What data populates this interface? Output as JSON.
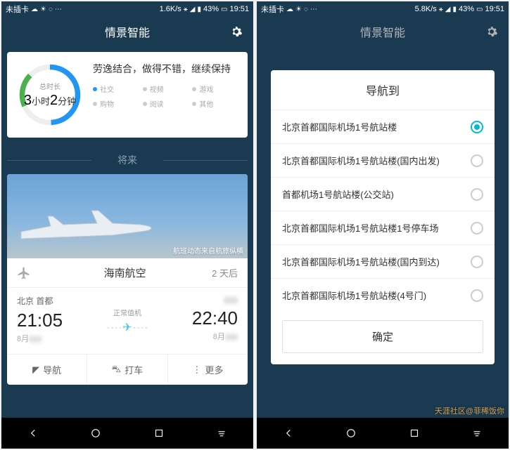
{
  "status": {
    "no_sim": "未插卡",
    "speed_left": "1.6K/s",
    "speed_right": "5.8K/s",
    "battery": "43%",
    "time": "19:51"
  },
  "header": {
    "title": "情景智能"
  },
  "wellness": {
    "ring_label": "总时长",
    "hours": "3",
    "hour_unit": "小时",
    "minutes": "2",
    "min_unit": "分钟",
    "message": "劳逸结合，做得不错，继续保持",
    "legend": {
      "social": "社交",
      "video": "视频",
      "game": "游戏",
      "shop": "购物",
      "read": "阅读",
      "other": "其他"
    }
  },
  "section_future": "将来",
  "flight": {
    "credit": "航班动态来自航旅纵横",
    "airline": "海南航空",
    "days": "2 天后",
    "dep_city": "北京 首都",
    "dep_time": "21:05",
    "dep_date": "8月",
    "arr_time": "22:40",
    "arr_date": "8月",
    "status": "正常值机",
    "actions": {
      "nav": "导航",
      "taxi": "打车",
      "more": "更多"
    }
  },
  "dialog": {
    "title": "导航到",
    "options": [
      "北京首都国际机场1号航站楼",
      "北京首都国际机场1号航站楼(国内出发)",
      "首都机场1号航站楼(公交站)",
      "北京首都国际机场1号航站楼1号停车场",
      "北京首都国际机场1号航站楼(国内到达)",
      "北京首都国际机场1号航站楼(4号门)"
    ],
    "selected": 0,
    "confirm": "确定"
  },
  "watermark": "天涯社区@菲稀饭你"
}
